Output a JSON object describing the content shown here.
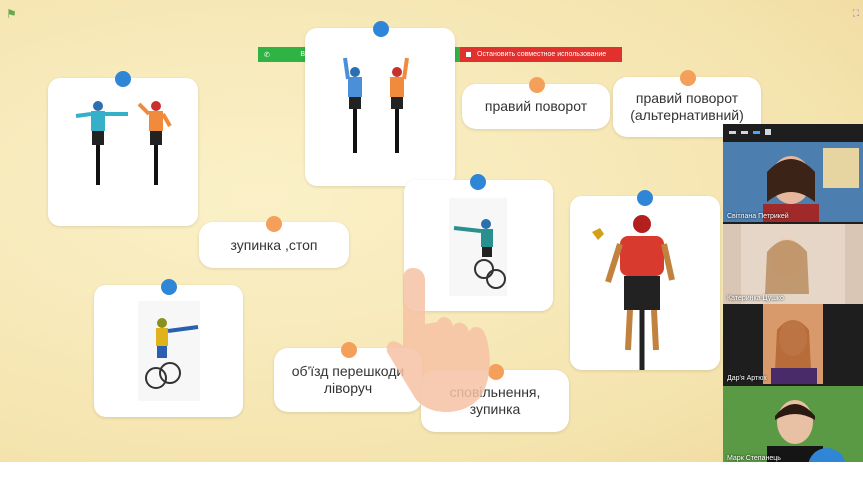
{
  "app": {
    "share_notice": "Вы запустили демонстрацию экрана",
    "stop_share": "Остановить совместное использование"
  },
  "labels": {
    "right_turn": "правий поворот",
    "right_turn_alt": "правий поворот (альтернативний)",
    "stop": "зупинка ,стоп",
    "detour_left": "об'їзд перешкоди ліворуч",
    "slowdown": "сповільнення, зупинка"
  },
  "participants": [
    {
      "name": "Світлана Петрикей"
    },
    {
      "name": "Катеринка Цушко"
    },
    {
      "name": "Дар'я Артюх"
    },
    {
      "name": "Марк Степанець"
    }
  ],
  "colors": {
    "board": "#f6e9b7",
    "pin_blue": "#2f86d6",
    "pin_orange": "#f4a05a",
    "share_green": "#2fb344",
    "share_red": "#e0312e"
  },
  "icons": [
    "flag-icon",
    "fullscreen-icon",
    "shield-icon",
    "video-layout-icons"
  ]
}
